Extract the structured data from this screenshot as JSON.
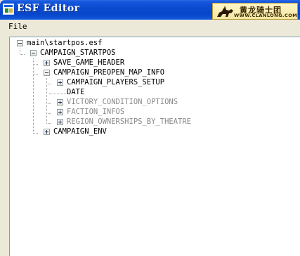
{
  "window": {
    "title": "ESF Editor"
  },
  "watermark": {
    "name_cn": "黄龙骑士团",
    "url": "WWW.CLANLONG.COM"
  },
  "menu": {
    "file_label": "File"
  },
  "tree": {
    "root": "main\\startpos.esf",
    "campaign_startpos": "CAMPAIGN_STARTPOS",
    "save_game_header": "SAVE_GAME_HEADER",
    "campaign_preopen_map_info": "CAMPAIGN_PREOPEN_MAP_INFO",
    "campaign_players_setup": "CAMPAIGN_PLAYERS_SETUP",
    "date": "DATE",
    "victory_condition_options": "VICTORY_CONDITION_OPTIONS",
    "faction_infos": "FACTION_INFOS",
    "region_ownerships_by_theatre": "REGION_OWNERSHIPS_BY_THEATRE",
    "campaign_env": "CAMPAIGN_ENV"
  }
}
